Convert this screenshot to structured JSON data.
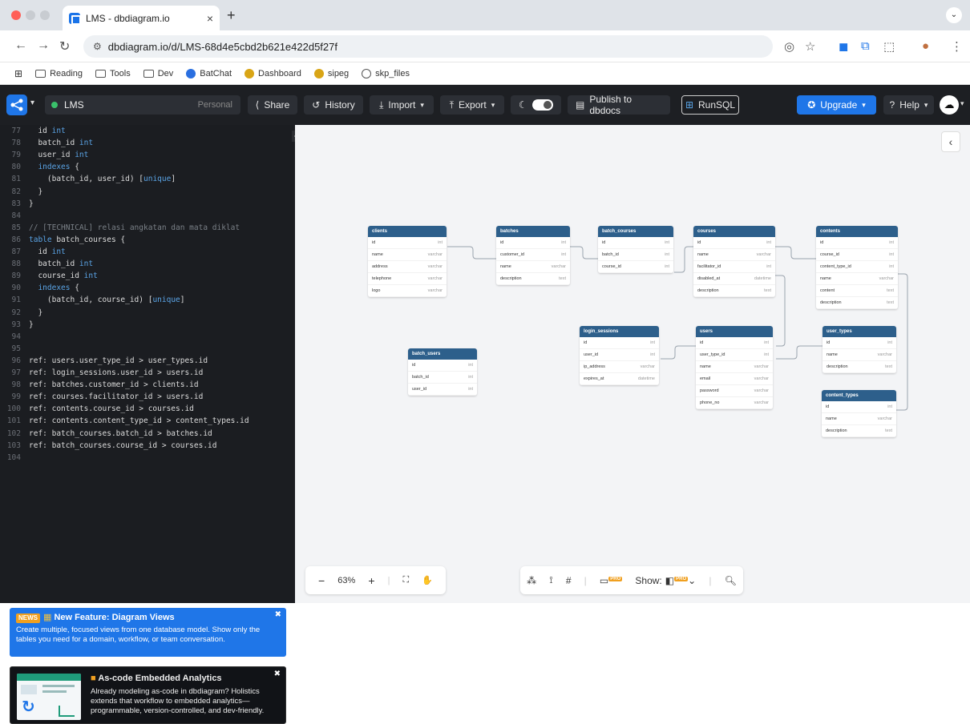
{
  "browser": {
    "tab_title": "LMS - dbdiagram.io",
    "url": "dbdiagram.io/d/LMS-68d4e5cbd2b621e422d5f27f",
    "bookmarks": [
      {
        "label": "Reading",
        "icon": "folder-icon"
      },
      {
        "label": "Tools",
        "icon": "folder-icon"
      },
      {
        "label": "Dev",
        "icon": "folder-icon"
      },
      {
        "label": "BatChat",
        "icon": "batchat-icon"
      },
      {
        "label": "Dashboard",
        "icon": "dashboard-icon"
      },
      {
        "label": "sipeg",
        "icon": "sipeg-icon"
      },
      {
        "label": "skp_files",
        "icon": "globe-icon"
      }
    ]
  },
  "app": {
    "project_name": "LMS",
    "workspace": "Personal",
    "buttons": {
      "share": "Share",
      "history": "History",
      "import": "Import",
      "export": "Export",
      "publish": "Publish to dbdocs",
      "runsql": "RunSQL",
      "upgrade": "Upgrade",
      "help": "Help"
    },
    "accent": "#1f76e8"
  },
  "code": [
    {
      "n": "77",
      "t": "  id int"
    },
    {
      "n": "78",
      "t": "  batch_id int"
    },
    {
      "n": "79",
      "t": "  user_id int"
    },
    {
      "n": "80",
      "t": "  indexes {"
    },
    {
      "n": "81",
      "t": "    (batch_id, user_id) [unique]"
    },
    {
      "n": "82",
      "t": "  }"
    },
    {
      "n": "83",
      "t": "}"
    },
    {
      "n": "84",
      "t": ""
    },
    {
      "n": "85",
      "t": "// [TECHNICAL] relasi angkatan dan mata diklat"
    },
    {
      "n": "86",
      "t": "table batch_courses {"
    },
    {
      "n": "87",
      "t": "  id int"
    },
    {
      "n": "88",
      "t": "  batch_id int"
    },
    {
      "n": "89",
      "t": "  course_id int"
    },
    {
      "n": "90",
      "t": "  indexes {"
    },
    {
      "n": "91",
      "t": "    (batch_id, course_id) [unique]"
    },
    {
      "n": "92",
      "t": "  }"
    },
    {
      "n": "93",
      "t": "}"
    },
    {
      "n": "94",
      "t": ""
    },
    {
      "n": "95",
      "t": ""
    },
    {
      "n": "96",
      "t": "ref: users.user_type_id > user_types.id"
    },
    {
      "n": "97",
      "t": "ref: login_sessions.user_id > users.id"
    },
    {
      "n": "98",
      "t": "ref: batches.customer_id > clients.id"
    },
    {
      "n": "99",
      "t": "ref: courses.facilitator_id > users.id"
    },
    {
      "n": "100",
      "t": "ref: contents.course_id > courses.id"
    },
    {
      "n": "101",
      "t": "ref: contents.content_type_id > content_types.id"
    },
    {
      "n": "102",
      "t": "ref: batch_courses.batch_id > batches.id"
    },
    {
      "n": "103",
      "t": "ref: batch_courses.course_id > courses.id"
    },
    {
      "n": "104",
      "t": ""
    }
  ],
  "news": {
    "tag": "NEWS",
    "title": "New Feature: Diagram Views",
    "body": "Create multiple, focused views from one database model. Show only the tables you need for a domain, workflow, or team conversation."
  },
  "promo": {
    "title": "As-code Embedded Analytics",
    "body": "Already modeling as-code in dbdiagram? Holistics extends that workflow to embedded analytics—programmable, version-controlled, and dev-friendly."
  },
  "tables": [
    {
      "id": "clients",
      "title": "clients",
      "rows": [
        [
          "id",
          "int"
        ],
        [
          "name",
          "varchar"
        ],
        [
          "address",
          "varchar"
        ],
        [
          "telephone",
          "varchar"
        ],
        [
          "logo",
          "varchar"
        ]
      ]
    },
    {
      "id": "batches",
      "title": "batches",
      "rows": [
        [
          "id",
          "int"
        ],
        [
          "customer_id",
          "int"
        ],
        [
          "name",
          "varchar"
        ],
        [
          "description",
          "text"
        ]
      ]
    },
    {
      "id": "batch_courses",
      "title": "batch_courses",
      "rows": [
        [
          "id",
          "int"
        ],
        [
          "batch_id",
          "int"
        ],
        [
          "course_id",
          "int"
        ]
      ]
    },
    {
      "id": "courses",
      "title": "courses",
      "rows": [
        [
          "id",
          "int"
        ],
        [
          "name",
          "varchar"
        ],
        [
          "facilitator_id",
          "int"
        ],
        [
          "disabled_at",
          "datetime"
        ],
        [
          "description",
          "text"
        ]
      ]
    },
    {
      "id": "contents",
      "title": "contents",
      "rows": [
        [
          "id",
          "int"
        ],
        [
          "course_id",
          "int"
        ],
        [
          "content_type_id",
          "int"
        ],
        [
          "name",
          "varchar"
        ],
        [
          "content",
          "text"
        ],
        [
          "description",
          "text"
        ]
      ]
    },
    {
      "id": "login_sessions",
      "title": "login_sessions",
      "rows": [
        [
          "id",
          "int"
        ],
        [
          "user_id",
          "int"
        ],
        [
          "ip_address",
          "varchar"
        ],
        [
          "expires_at",
          "datetime"
        ]
      ]
    },
    {
      "id": "users",
      "title": "users",
      "rows": [
        [
          "id",
          "int"
        ],
        [
          "user_type_id",
          "int"
        ],
        [
          "name",
          "varchar"
        ],
        [
          "email",
          "varchar"
        ],
        [
          "password",
          "varchar"
        ],
        [
          "phone_no",
          "varchar"
        ]
      ]
    },
    {
      "id": "user_types",
      "title": "user_types",
      "rows": [
        [
          "id",
          "int"
        ],
        [
          "name",
          "varchar"
        ],
        [
          "description",
          "text"
        ]
      ]
    },
    {
      "id": "batch_users",
      "title": "batch_users",
      "rows": [
        [
          "id",
          "int"
        ],
        [
          "batch_id",
          "int"
        ],
        [
          "user_id",
          "int"
        ]
      ]
    },
    {
      "id": "content_types",
      "title": "content_types",
      "rows": [
        [
          "id",
          "int"
        ],
        [
          "name",
          "varchar"
        ],
        [
          "description",
          "text"
        ]
      ]
    }
  ],
  "canvas": {
    "zoom": "63%",
    "show_label": "Show:"
  }
}
